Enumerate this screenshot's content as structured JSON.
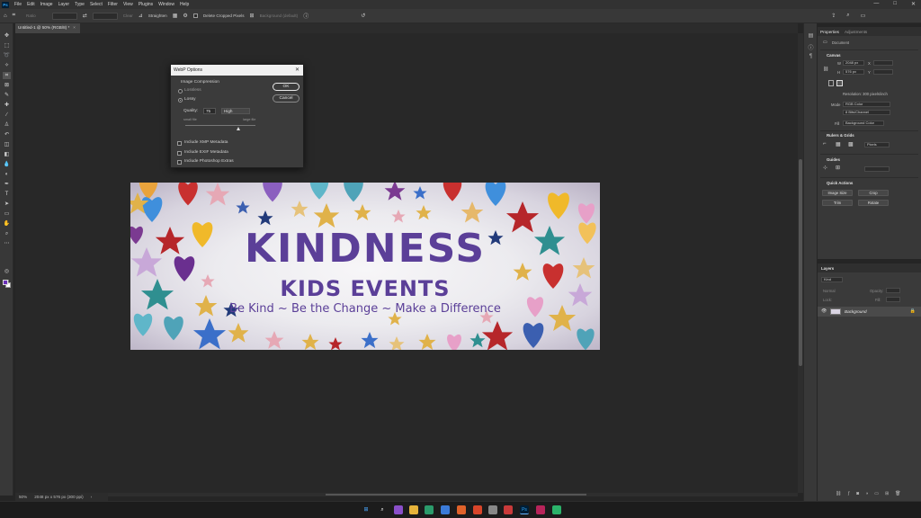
{
  "menubar": {
    "logo": "Ps",
    "items": [
      "File",
      "Edit",
      "Image",
      "Layer",
      "Type",
      "Select",
      "Filter",
      "View",
      "Plugins",
      "Window",
      "Help"
    ],
    "window_controls": [
      "—",
      "□",
      "✕"
    ]
  },
  "options_bar": {
    "ratio_label": "Ratio",
    "clear_label": "Clear",
    "straighten_label": "Straighten",
    "delete_cropped_label": "Delete Cropped Pixels",
    "content_aware_label": "Background (default)"
  },
  "document": {
    "tab_title": "Untitled-1 @ 50% (RGB/8) *",
    "tab_close": "×",
    "zoom": "50%",
    "doc_info": "2048 px x 576 px (300 ppi)"
  },
  "banner": {
    "title": "KINDNESS",
    "subtitle": "KIDS EVENTS",
    "tagline": "Be Kind ~ Be the Change ~ Make a Difference",
    "text_color": "#5b3f98"
  },
  "dialog": {
    "title": "WebP Options",
    "close": "✕",
    "section_label": "Image Compression",
    "lossless_label": "Lossless",
    "lossy_label": "Lossy",
    "quality_label": "Quality:",
    "quality_value": "75",
    "quality_preset": "High",
    "small_file_label": "small file",
    "large_file_label": "large file",
    "quality_fraction": 0.75,
    "xmp_label": "Include XMP Metadata",
    "exif_label": "Include EXIF Metadata",
    "extras_label": "Include Photoshop Extras",
    "ok_label": "OK",
    "cancel_label": "Cancel"
  },
  "properties": {
    "tabs": [
      "Properties",
      "Adjustments"
    ],
    "document_label": "Document",
    "canvas_head": "Canvas",
    "w_label": "W",
    "w_value": "2048 px",
    "h_label": "H",
    "h_value": "576 px",
    "x_label": "X",
    "y_label": "Y",
    "resolution": "Resolution: 300 pixels/inch",
    "mode_label": "Mode",
    "mode_value": "RGB Color",
    "bits_value": "8 Bits/Channel",
    "fill_label": "Fill",
    "fill_value": "Background Color",
    "rulers_head": "Rulers & Grids",
    "units_value": "Pixels",
    "guides_head": "Guides",
    "quick_head": "Quick Actions",
    "btn_image_size": "Image Size",
    "btn_crop": "Crop",
    "btn_trim": "Trim",
    "btn_rotate": "Rotate"
  },
  "layers": {
    "tab": "Layers",
    "kind_label": "Kind",
    "normal_label": "Normal",
    "opacity_label": "Opacity:",
    "lock_label": "Lock:",
    "fill_label": "Fill:",
    "layer_name": "Background"
  }
}
